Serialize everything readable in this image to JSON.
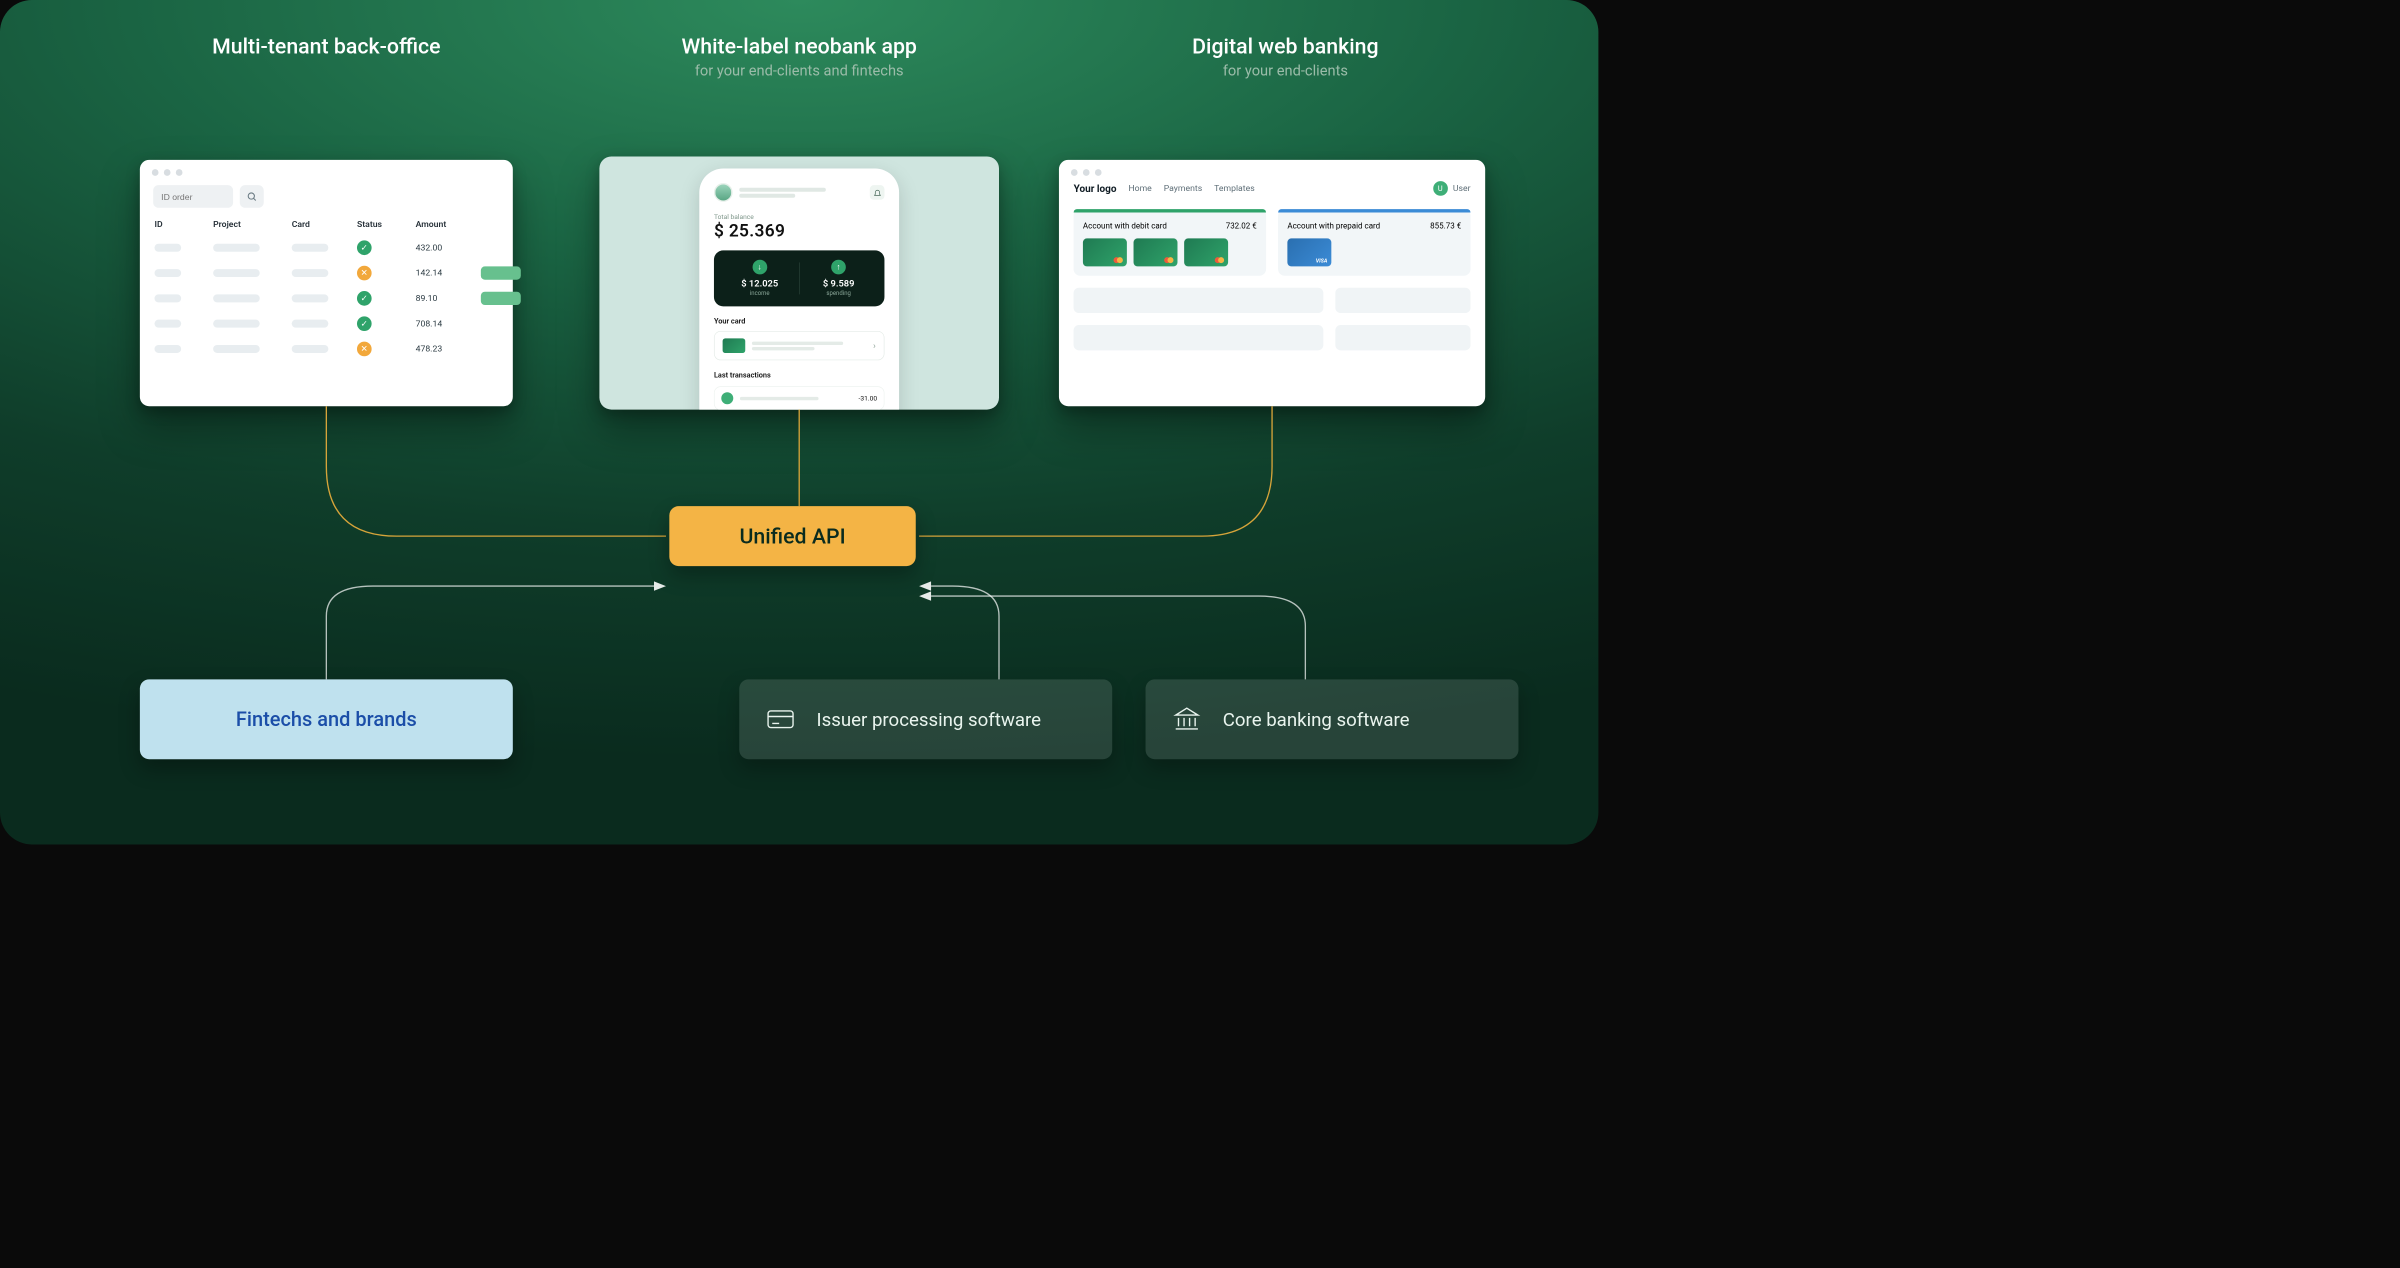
{
  "columns": {
    "left": {
      "title": "Multi-tenant back-office",
      "sub": ""
    },
    "mid": {
      "title": "White-label neobank app",
      "sub": "for your end-clients and fintechs"
    },
    "right": {
      "title": "Digital web banking",
      "sub": "for your end-clients"
    }
  },
  "backoffice": {
    "search_placeholder": "ID order",
    "headers": {
      "id": "ID",
      "project": "Project",
      "card": "Card",
      "status": "Status",
      "amount": "Amount"
    },
    "rows": [
      {
        "status": "ok",
        "amount": "432.00",
        "pill": false
      },
      {
        "status": "bad",
        "amount": "142.14",
        "pill": true
      },
      {
        "status": "ok",
        "amount": "89.10",
        "pill": true
      },
      {
        "status": "ok",
        "amount": "708.14",
        "pill": false
      },
      {
        "status": "bad",
        "amount": "478.23",
        "pill": false
      }
    ]
  },
  "neobank": {
    "balance_label": "Total balance",
    "balance": "$ 25.369",
    "income": {
      "value": "$ 12.025",
      "label": "income"
    },
    "spending": {
      "value": "$ 9.589",
      "label": "spending"
    },
    "your_card": "Your card",
    "last_tx": "Last transactions",
    "tx_amount": "-31.00"
  },
  "webbank": {
    "logo": "Your logo",
    "nav": [
      "Home",
      "Payments",
      "Templates"
    ],
    "user_initial": "U",
    "user_name": "User",
    "acct_a": {
      "title": "Account with debit card",
      "amount": "732.02 €"
    },
    "acct_b": {
      "title": "Account with prepaid card",
      "amount": "855.73 €"
    }
  },
  "hub": {
    "api": "Unified API"
  },
  "bottom": {
    "fintech": "Fintechs and brands",
    "issuer": "Issuer processing software",
    "core": "Core banking software"
  }
}
